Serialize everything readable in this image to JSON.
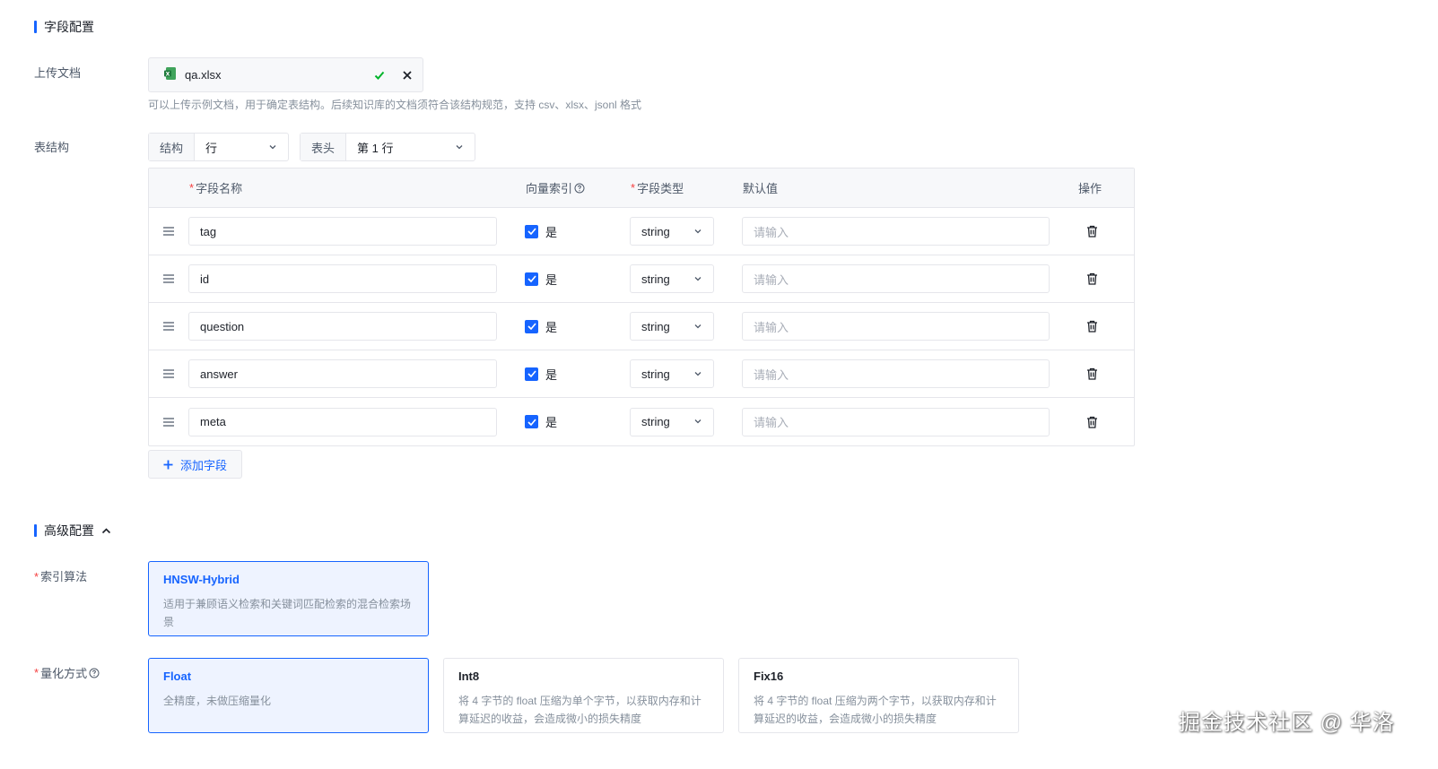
{
  "sections": {
    "field_config": "字段配置",
    "advanced_config": "高级配置"
  },
  "upload": {
    "label": "上传文档",
    "file_name": "qa.xlsx",
    "hint": "可以上传示例文档，用于确定表结构。后续知识库的文档须符合该结构规范，支持 csv、xlsx、jsonl 格式"
  },
  "table_structure": {
    "label": "表结构",
    "structure_prefix": "结构",
    "structure_value": "行",
    "header_prefix": "表头",
    "header_value": "第 1 行"
  },
  "fields_table": {
    "columns": {
      "name": "字段名称",
      "vector_index": "向量索引",
      "type": "字段类型",
      "default": "默认值",
      "actions": "操作"
    },
    "rows": [
      {
        "name": "tag",
        "vector_index_label": "是",
        "type": "string",
        "default_placeholder": "请输入"
      },
      {
        "name": "id",
        "vector_index_label": "是",
        "type": "string",
        "default_placeholder": "请输入"
      },
      {
        "name": "question",
        "vector_index_label": "是",
        "type": "string",
        "default_placeholder": "请输入"
      },
      {
        "name": "answer",
        "vector_index_label": "是",
        "type": "string",
        "default_placeholder": "请输入"
      },
      {
        "name": "meta",
        "vector_index_label": "是",
        "type": "string",
        "default_placeholder": "请输入"
      }
    ],
    "add_button": "添加字段"
  },
  "index_algorithm": {
    "label": "索引算法",
    "options": [
      {
        "title": "HNSW-Hybrid",
        "desc": "适用于兼顾语义检索和关键词匹配检索的混合检索场景",
        "selected": true
      }
    ]
  },
  "quantization": {
    "label": "量化方式",
    "options": [
      {
        "title": "Float",
        "desc": "全精度，未做压缩量化",
        "selected": true
      },
      {
        "title": "Int8",
        "desc": "将 4 字节的 float 压缩为单个字节，以获取内存和计算延迟的收益，会造成微小的损失精度",
        "selected": false
      },
      {
        "title": "Fix16",
        "desc": "将 4 字节的 float 压缩为两个字节，以获取内存和计算延迟的收益，会造成微小的损失精度",
        "selected": false
      }
    ]
  },
  "watermark": "掘金技术社区 @ 华洛",
  "colors": {
    "accent": "#1664ff",
    "success": "#00b42a",
    "required": "#f53f3f"
  }
}
